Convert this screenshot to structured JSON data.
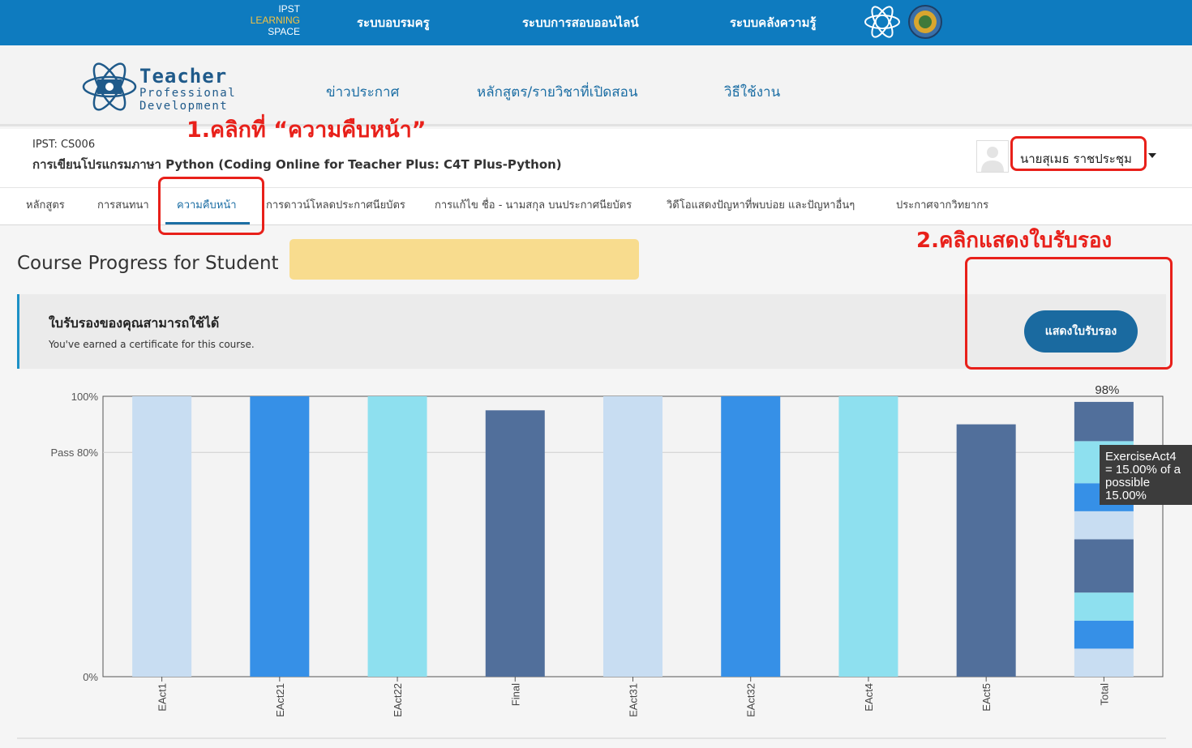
{
  "topbar": {
    "logo_lines": [
      "IPST",
      "LEARNING",
      "SPACE"
    ],
    "nav": [
      "ระบบอบรมครู",
      "ระบบการสอบออนไลน์",
      "ระบบคลังความรู้"
    ]
  },
  "header": {
    "logo_lines": [
      "Teacher",
      "Professional",
      "Development"
    ],
    "nav": [
      "ข่าวประกาศ",
      "หลักสูตร/รายวิชาที่เปิดสอน",
      "วิธีใช้งาน"
    ]
  },
  "course": {
    "code": "IPST: CS006",
    "name": "การเขียนโปรแกรมภาษา Python (Coding Online for Teacher Plus: C4T Plus-Python)"
  },
  "user": {
    "name": "นายสุเมธ ราชประชุม"
  },
  "tabs": [
    "หลักสูตร",
    "การสนทนา",
    "ความคืบหน้า",
    "การดาวน์โหลดประกาศนียบัตร",
    "การแก้ไข ชื่อ - นามสกุล บนประกาศนียบัตร",
    "วิดีโอแสดงปัญหาที่พบบ่อย และปัญหาอื่นๆ",
    "ประกาศจากวิทยากร"
  ],
  "annotations": {
    "step1": "1.คลิกที่ “ความคืบหน้า”",
    "step2": "2.คลิกแสดงใบรับรอง"
  },
  "main": {
    "title": "Course Progress for Student",
    "cert_title": "ใบรับรองของคุณสามารถใช้ได้",
    "cert_sub": "You've earned a certificate for this course.",
    "cert_button": "แสดงใบรับรอง"
  },
  "chart_data": {
    "type": "bar",
    "categories": [
      "EAct1",
      "EAct21",
      "EAct22",
      "Final",
      "EAct31",
      "EAct32",
      "EAct4",
      "EAct5",
      "Total"
    ],
    "values": [
      100,
      100,
      100,
      95,
      100,
      100,
      100,
      90,
      98
    ],
    "ylim": [
      0,
      100
    ],
    "y_ticks": [
      {
        "value": 100,
        "label": "100%"
      },
      {
        "value": 80,
        "label": "Pass 80%"
      },
      {
        "value": 0,
        "label": "0%"
      }
    ],
    "total_label": "98%",
    "bar_colors": [
      "#c8ddf2",
      "#3690e7",
      "#8ee0ef",
      "#516f9b",
      "#c8ddf2",
      "#3690e7",
      "#8ee0ef",
      "#516f9b"
    ],
    "total_segments": [
      {
        "value": 10,
        "color": "#c8ddf2"
      },
      {
        "value": 10,
        "color": "#3690e7"
      },
      {
        "value": 10,
        "color": "#8ee0ef"
      },
      {
        "value": 19,
        "color": "#516f9b"
      },
      {
        "value": 10,
        "color": "#c8ddf2"
      },
      {
        "value": 10,
        "color": "#3690e7"
      },
      {
        "value": 15,
        "color": "#8ee0ef"
      },
      {
        "value": 14,
        "color": "#516f9b"
      }
    ],
    "tooltip_lines": [
      "ExerciseAct4",
      "= 15.00% of a",
      "possible",
      "15.00%"
    ]
  }
}
